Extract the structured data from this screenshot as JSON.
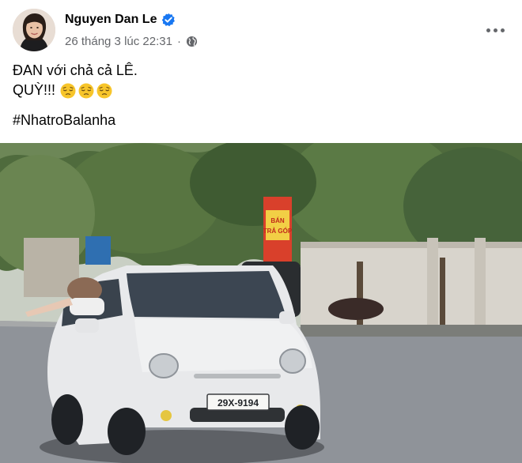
{
  "post": {
    "author": "Nguyen Dan Le",
    "verified": true,
    "timestamp": "26 tháng 3 lúc 22:31",
    "separator": "·",
    "privacy_icon": "globe-icon",
    "more_icon": "more-options-icon",
    "lines": [
      "ĐAN với chả cả LÊ.",
      "QUỲ!!!"
    ],
    "emoji_count": 3,
    "emoji_name": "pensive-face-emoji",
    "hashtag": "#NhatroBalanha",
    "photo": {
      "storefront_sign": "BÁN TRẢ GÓP",
      "license_plate": "29X-9194"
    }
  },
  "colors": {
    "verified": "#1877f2",
    "secondary_text": "#65676b",
    "emoji": "#f7c52b"
  }
}
